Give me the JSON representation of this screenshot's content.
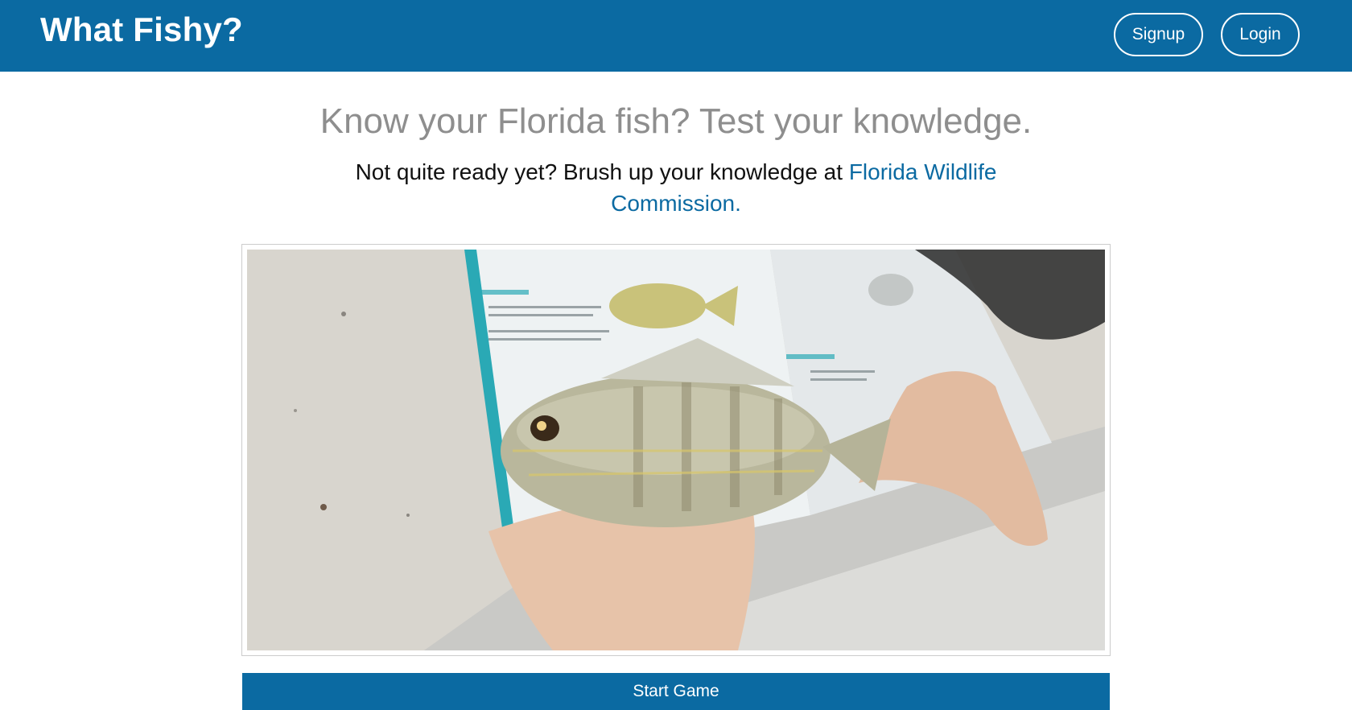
{
  "header": {
    "brand": "What Fishy?",
    "signup_label": "Signup",
    "login_label": "Login"
  },
  "main": {
    "headline": "Know your Florida fish? Test your knowledge.",
    "subtext_prefix": "Not quite ready yet? Brush up your knowledge at ",
    "subtext_link": "Florida Wildlife Commission.",
    "start_label": "Start Game"
  },
  "colors": {
    "brand_blue": "#0b6aa2",
    "headline_gray": "#8e8e8e"
  }
}
